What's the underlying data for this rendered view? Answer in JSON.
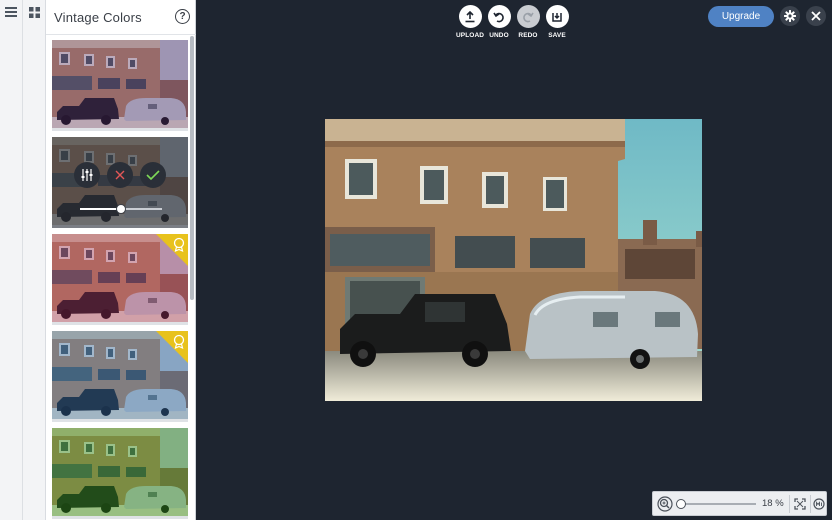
{
  "panel": {
    "title": "Vintage Colors",
    "filters": [
      {
        "tint": "#5b2a7a",
        "tint_opacity": 0.32,
        "premium": false,
        "active": false
      },
      {
        "tint": "#4a5060",
        "tint_opacity": 0.25,
        "premium": false,
        "active": true,
        "intensity_fraction": 0.5
      },
      {
        "tint": "#a8245f",
        "tint_opacity": 0.35,
        "premium": true,
        "active": false
      },
      {
        "tint": "#2f6cb0",
        "tint_opacity": 0.38,
        "premium": true,
        "active": false
      },
      {
        "tint": "#2e8f18",
        "tint_opacity": 0.42,
        "premium": false,
        "active": false
      }
    ]
  },
  "toolbar": {
    "upload": "UPLOAD",
    "undo": "UNDO",
    "redo": "REDO",
    "save": "SAVE"
  },
  "header": {
    "upgrade": "Upgrade"
  },
  "zoom": {
    "value_label": "18 %",
    "fraction": 0.0
  },
  "colors": {
    "workspace": "#1e2530",
    "accent": "#4f82c4",
    "premium": "#e8c21c",
    "confirm": "#7ed957",
    "cancel": "#e35757"
  }
}
